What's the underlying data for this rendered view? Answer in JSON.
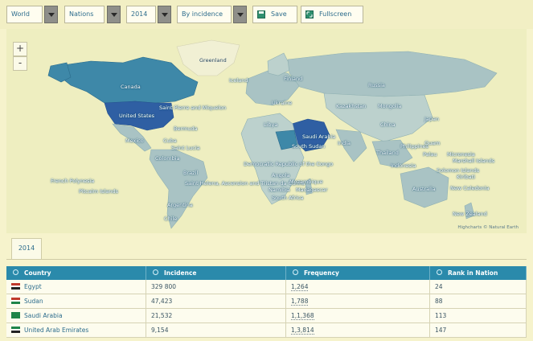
{
  "toolbar": {
    "region": "World",
    "level": "Nations",
    "year": "2014",
    "sort": "By incidence",
    "save_label": "Save",
    "fullscreen_label": "Fullscreen"
  },
  "map": {
    "zoom_in": "+",
    "zoom_out": "-",
    "attribution": "Highcharts © Natural Earth",
    "labels": {
      "greenland": "Greenland",
      "iceland": "Iceland",
      "finland": "Finland",
      "russia": "Russia",
      "canada": "Canada",
      "usa": "United States",
      "stpierre": "Saint Pierre and Miquelon",
      "kazakhstan": "Kazakhstan",
      "mongolia": "Mongolia",
      "ukraine": "Ukraine",
      "china": "China",
      "japan": "Japan",
      "bermuda": "Bermuda",
      "cuba": "Cuba",
      "saintlucia": "Saint Lucia",
      "mexico": "Mexico",
      "saudi": "Saudi Arabia",
      "sudan": "South Sudan",
      "libya": "Libya",
      "india": "India",
      "thailand": "Thailand",
      "philippines": "Philippines",
      "guam": "Guam",
      "palau": "Palau",
      "micronesia": "Micronesia",
      "marshall": "Marshall Islands",
      "solomon": "Solomon Islands",
      "indonesia": "Indonesia",
      "kiribati": "Kiribati",
      "french_polynesia": "French Polynesia",
      "pitcairn": "Pitcairn Islands",
      "colombia": "Colombia",
      "brazil": "Brazil",
      "saint_helena": "Saint Helena, Ascension and Tristan da Cunha",
      "democratic_congo": "Democratic Republic of the Congo",
      "angola": "Angola",
      "mozambique": "Mozambique",
      "namibia": "Namibia",
      "south_africa": "South Africa",
      "argentina": "Argentina",
      "chile": "Chile",
      "australia": "Australia",
      "new_caledonia": "New Caledonia",
      "new_zealand": "New Zealand",
      "madagascar": "Madagascar"
    }
  },
  "tab": "2014",
  "table": {
    "headers": [
      "Country",
      "Incidence",
      "Frequency",
      "Rank in Nation"
    ],
    "rows": [
      {
        "country": "Egypt",
        "incidence": "329 800",
        "frequency": "1,264",
        "rank": "24"
      },
      {
        "country": "Sudan",
        "incidence": "47,423",
        "frequency": "1,788",
        "rank": "88"
      },
      {
        "country": "Saudi Arabia",
        "incidence": "21,532",
        "frequency": "1,1,368",
        "rank": "113"
      },
      {
        "country": "United Arab Emirates",
        "incidence": "9,154",
        "frequency": "1,3,814",
        "rank": "147"
      }
    ],
    "flag_colors": [
      [
        "#c0392b",
        "#ffffff",
        "#222222"
      ],
      [
        "#c0392b",
        "#ffffff",
        "#1e8449"
      ],
      [
        "#1e8449",
        "#1e8449",
        "#1e8449"
      ],
      [
        "#1e8449",
        "#ffffff",
        "#222222"
      ]
    ]
  },
  "colors": {
    "accent": "#2a8aab",
    "map_dark": "#2f5fa3",
    "map_mid": "#3e88a8",
    "map_light": "#a9c3c4"
  }
}
